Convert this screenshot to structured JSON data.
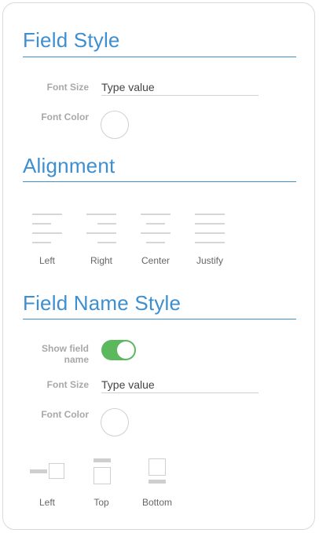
{
  "field_style": {
    "title": "Field Style",
    "font_size_label": "Font Size",
    "font_size_placeholder": "Type value",
    "font_color_label": "Font Color"
  },
  "alignment": {
    "title": "Alignment",
    "options": [
      {
        "label": "Left",
        "icon": "align-left-icon"
      },
      {
        "label": "Right",
        "icon": "align-right-icon"
      },
      {
        "label": "Center",
        "icon": "align-center-icon"
      },
      {
        "label": "Justify",
        "icon": "align-justify-icon"
      }
    ]
  },
  "field_name_style": {
    "title": "Field Name Style",
    "show_label": "Show field name",
    "show_enabled": true,
    "font_size_label": "Font Size",
    "font_size_placeholder": "Type value",
    "font_color_label": "Font Color",
    "positions": [
      {
        "label": "Left",
        "icon": "label-left-icon"
      },
      {
        "label": "Top",
        "icon": "label-top-icon"
      },
      {
        "label": "Bottom",
        "icon": "label-bottom-icon"
      }
    ]
  },
  "colors": {
    "accent": "#3d8fd0",
    "toggle_on": "#5cb85c"
  }
}
